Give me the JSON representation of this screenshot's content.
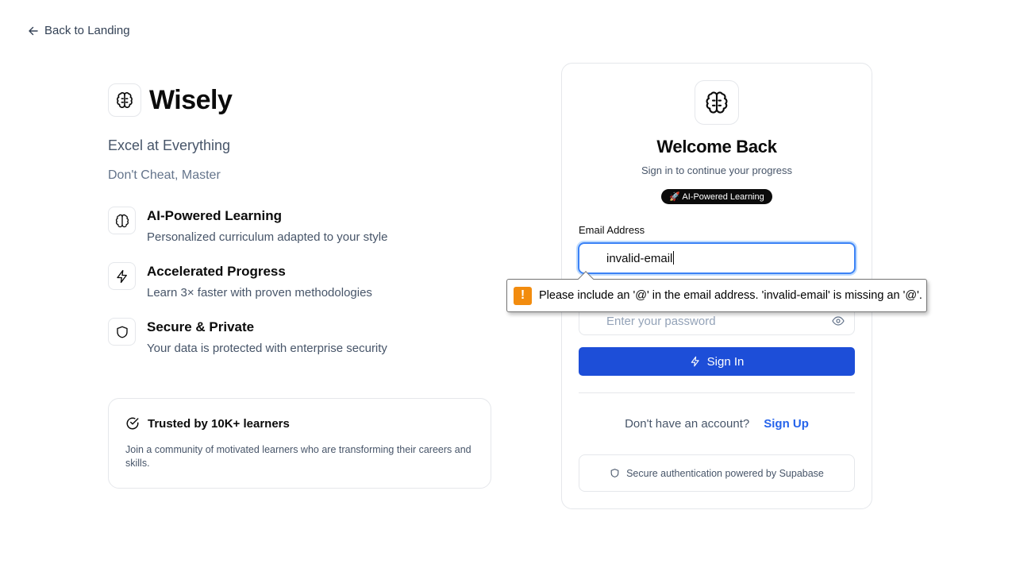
{
  "nav": {
    "back_label": "Back to Landing"
  },
  "brand": {
    "name": "Wisely",
    "tagline": "Excel at Everything",
    "subtagline": "Don't Cheat, Master"
  },
  "features": [
    {
      "icon": "brain-icon",
      "title": "AI-Powered Learning",
      "desc": "Personalized curriculum adapted to your style"
    },
    {
      "icon": "lightning-icon",
      "title": "Accelerated Progress",
      "desc": "Learn 3× faster with proven methodologies"
    },
    {
      "icon": "shield-icon",
      "title": "Secure & Private",
      "desc": "Your data is protected with enterprise security"
    }
  ],
  "trust": {
    "title": "Trusted by 10K+ learners",
    "desc": "Join a community of motivated learners who are transforming their careers and skills."
  },
  "card": {
    "title": "Welcome Back",
    "subtitle": "Sign in to continue your progress",
    "pill": "🚀 AI-Powered Learning",
    "email_label": "Email Address",
    "email_value": "invalid-email",
    "password_placeholder": "Enter your password",
    "signin_label": "Sign In",
    "signup_prompt": "Don't have an account?",
    "signup_link": "Sign Up",
    "secure_note": "Secure authentication powered by Supabase"
  },
  "validation": {
    "message": "Please include an '@' in the email address. 'invalid-email' is missing an '@'."
  },
  "colors": {
    "primary": "#1d4ed8",
    "link": "#2563eb",
    "focus": "#3b82f6",
    "warning": "#f28c0f"
  }
}
